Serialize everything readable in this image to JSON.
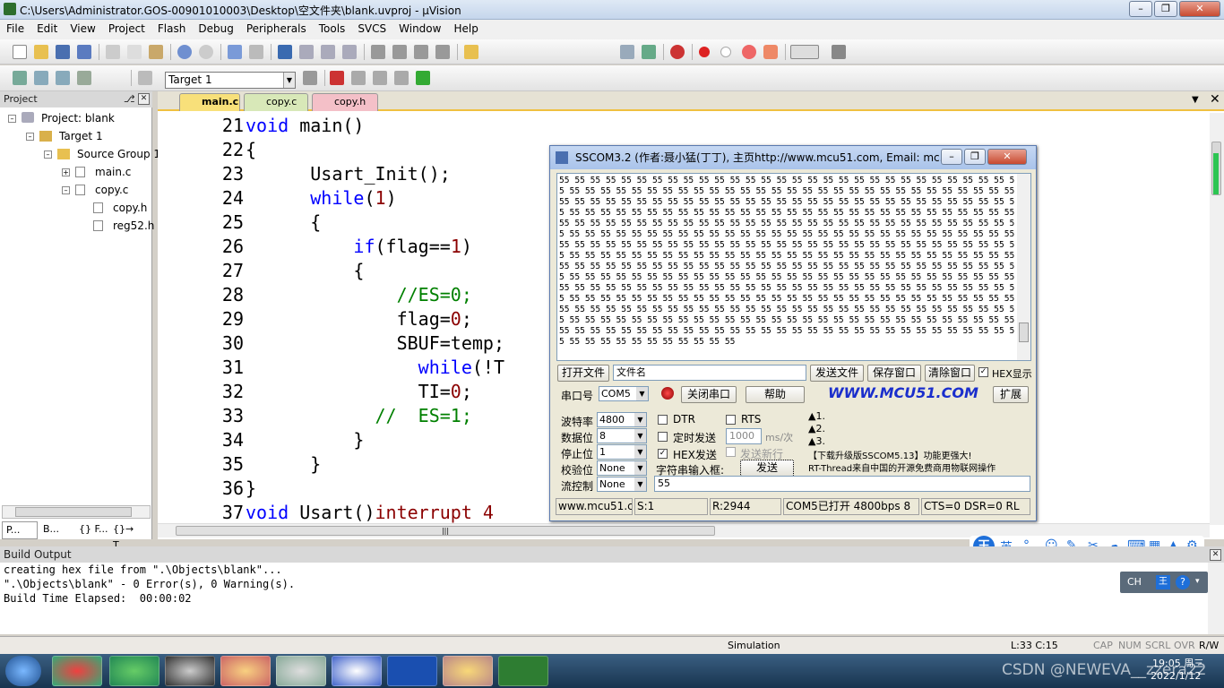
{
  "window": {
    "title": "C:\\Users\\Administrator.GOS-00901010003\\Desktop\\空文件夹\\blank.uvproj - µVision"
  },
  "menu": [
    "File",
    "Edit",
    "View",
    "Project",
    "Flash",
    "Debug",
    "Peripherals",
    "Tools",
    "SVCS",
    "Window",
    "Help"
  ],
  "toolbar2": {
    "target": "Target 1"
  },
  "project": {
    "header": "Project",
    "root": "Project: blank",
    "target": "Target 1",
    "group": "Source Group 1",
    "files": [
      "main.c",
      "copy.c",
      "copy.h",
      "reg52.h"
    ],
    "bottom_tabs": [
      "P...",
      "B...",
      "{} F...",
      "{}→ T..."
    ]
  },
  "editor": {
    "tabs": [
      "main.c",
      "copy.c",
      "copy.h"
    ],
    "lines": [
      {
        "n": "21",
        "segs": [
          {
            "t": "void",
            "c": "kw"
          },
          {
            "t": " main()",
            "c": ""
          }
        ]
      },
      {
        "n": "22",
        "segs": [
          {
            "t": "{",
            "c": ""
          }
        ]
      },
      {
        "n": "23",
        "segs": [
          {
            "t": "      Usart_Init();",
            "c": ""
          }
        ]
      },
      {
        "n": "24",
        "segs": [
          {
            "t": "      ",
            "c": ""
          },
          {
            "t": "while",
            "c": "kw"
          },
          {
            "t": "(",
            "c": ""
          },
          {
            "t": "1",
            "c": "num"
          },
          {
            "t": ")",
            "c": ""
          }
        ]
      },
      {
        "n": "25",
        "segs": [
          {
            "t": "      {",
            "c": ""
          }
        ]
      },
      {
        "n": "26",
        "segs": [
          {
            "t": "          ",
            "c": ""
          },
          {
            "t": "if",
            "c": "kw"
          },
          {
            "t": "(flag==",
            "c": ""
          },
          {
            "t": "1",
            "c": "num"
          },
          {
            "t": ")",
            "c": ""
          }
        ]
      },
      {
        "n": "27",
        "segs": [
          {
            "t": "          {",
            "c": ""
          }
        ]
      },
      {
        "n": "28",
        "segs": [
          {
            "t": "              ",
            "c": ""
          },
          {
            "t": "//ES=0;",
            "c": "cm"
          }
        ]
      },
      {
        "n": "29",
        "segs": [
          {
            "t": "              flag=",
            "c": ""
          },
          {
            "t": "0",
            "c": "num"
          },
          {
            "t": ";",
            "c": ""
          }
        ]
      },
      {
        "n": "30",
        "segs": [
          {
            "t": "              SBUF=temp;",
            "c": ""
          }
        ]
      },
      {
        "n": "31",
        "segs": [
          {
            "t": "                ",
            "c": ""
          },
          {
            "t": "while",
            "c": "kw"
          },
          {
            "t": "(!T",
            "c": ""
          }
        ]
      },
      {
        "n": "32",
        "segs": [
          {
            "t": "                TI=",
            "c": ""
          },
          {
            "t": "0",
            "c": "num"
          },
          {
            "t": ";",
            "c": ""
          }
        ]
      },
      {
        "n": "33",
        "segs": [
          {
            "t": "            ",
            "c": ""
          },
          {
            "t": "//  ES=1;",
            "c": "cm"
          }
        ]
      },
      {
        "n": "34",
        "segs": [
          {
            "t": "          }",
            "c": ""
          }
        ]
      },
      {
        "n": "35",
        "segs": [
          {
            "t": "      }",
            "c": ""
          }
        ]
      },
      {
        "n": "36",
        "segs": [
          {
            "t": "}",
            "c": ""
          }
        ]
      },
      {
        "n": "37",
        "segs": [
          {
            "t": "void",
            "c": "kw"
          },
          {
            "t": " Usart()",
            "c": ""
          },
          {
            "t": "interrupt 4",
            "c": "num"
          }
        ]
      }
    ]
  },
  "sscom": {
    "title": "SSCOM3.2 (作者:聂小猛(丁丁), 主页http://www.mcu51.com,  Email: mc...",
    "rx_text": "55 55 55 55 55 55 55 55 55 55 55 55 55 55 55 55 55 55 55 55 55 55 55 55 55 55 55 55 55 55 55 55 55 55 55 55 55 55 55 55 55 55 55 55 55 55 55 55 55 55 55 55 55 55 55 55 55 55 55 55 55 55 55 55 55 55 55 55 55 55 55 55 55 55 55 55 55 55 55 55 55 55 55 55 55 55 55 55 55 55 55 55 55 55 55 55 55 55 55 55 55 55 55 55 55 55 55 55 55 55 55 55 55 55 55 55 55 55 55 55 55 55 55 55 55 55 55 55 55 55 55 55 55 55 55 55 55 55 55 55 55 55 55 55 55 55 55 55 55 55 55 55 55 55 55 55 55 55 55 55 55 55 55 55 55 55 55 55 55 55 55 55 55 55 55 55 55 55 55 55 55 55 55 55 55 55 55 55 55 55 55 55 55 55 55 55 55 55 55 55 55 55 55 55 55 55 55 55 55 55 55 55 55 55 55 55 55 55 55 55 55 55 55 55 55 55 55 55 55 55 55 55 55 55 55 55 55 55 55 55 55 55 55 55 55 55 55 55 55 55 55 55 55 55 55 55 55 55 55 55 55 55 55 55 55 55 55 55 55 55 55 55 55 55 55 55 55 55 55 55 55 55 55 55 55 55 55 55 55 55 55 55 55 55 55 55 55 55 55 55 55 55 55 55 55 55 55 55 55 55 55 55 55 55 55 55 55 55 55 55 55 55 55 55 55 55 55 55 55 55 55 55 55 55 55 55 55 55 55 55 55 55 55 55 55 55 55 55 55 55 55 55 55 55 55 55 55 55 55 55 55 55 55 55 55 55 55 55 55 55 55 55 55 55 55 55 55 55 55 55 55 55 55 55 55 55 55 55 55 55 55 55 55 55 55 55 55 55 55 55 55 55 55 55 55 55 55 55 55 55 55 55 55 55 55 55 55 55 55 55 55 55 55 55 55 55 55 55 55 55 55 55 55 55 55 55 55 55 55 55 55 55 55 55 55 55 55 55 55 55 55 55 55 55",
    "btn_open_file": "打开文件",
    "file_name": "文件名",
    "btn_send_file": "发送文件",
    "btn_save_window": "保存窗口",
    "btn_clear_window": "清除窗口",
    "hex_display": "HEX显示",
    "port_label": "串口号",
    "port_value": "COM5",
    "btn_close_port": "关闭串口",
    "btn_help": "帮助",
    "website": "WWW.MCU51.COM",
    "btn_expand": "扩展",
    "baud_label": "波特率",
    "baud_value": "4800",
    "data_label": "数据位",
    "data_value": "8",
    "stop_label": "停止位",
    "stop_value": "1",
    "parity_label": "校验位",
    "parity_value": "None",
    "flow_label": "流控制",
    "flow_value": "None",
    "dtr": "DTR",
    "rts": "RTS",
    "timed_send": "定时发送",
    "timer_value": "1000",
    "timer_unit": "ms/次",
    "hex_send": "HEX发送",
    "send_newline": "发送新行",
    "str_input_label": "字符串输入框:",
    "btn_send": "发送",
    "input_value": "55",
    "info": [
      "▲1.",
      "▲2.",
      "▲3.",
      "【下载升级版SSCOM5.13】功能更强大!",
      "RT-Thread来自中国的开源免费商用物联网操作"
    ],
    "status": {
      "site": "www.mcu51.cor",
      "s": "S:1",
      "r": "R:2944",
      "port": "COM5已打开  4800bps  8",
      "lines": "CTS=0 DSR=0 RL"
    }
  },
  "build": {
    "header": "Build Output",
    "lines": [
      "creating hex file from \".\\Objects\\blank\"...",
      "\".\\Objects\\blank\" - 0 Error(s), 0 Warning(s).",
      "Build Time Elapsed:  00:00:02"
    ]
  },
  "statusbar": {
    "mode": "Simulation",
    "pos": "L:33 C:15",
    "caps": "CAP",
    "num": "NUM",
    "scrl": "SCRL",
    "ovr": "OVR",
    "rw": "R/W"
  },
  "ime": {
    "mode": "英",
    "lang": "CH"
  },
  "taskbar": {
    "time": "19:05 周三",
    "date": "2022/1/12",
    "watermark": "CSDN @NEWEVA__zzera22"
  }
}
